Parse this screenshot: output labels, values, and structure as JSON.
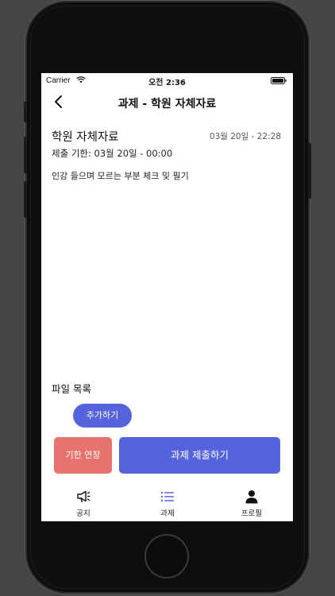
{
  "status_bar": {
    "carrier": "Carrier",
    "time": "오전 2:36"
  },
  "nav": {
    "title": "과제 - 학원 자체자료"
  },
  "assignment": {
    "title": "학원 자체자료",
    "posted_at": "03월 20일 - 22:28",
    "deadline": "제출 기한: 03월 20일 - 00:00",
    "content": "인강 들으며 모르는 부분 체크 및 필기"
  },
  "files": {
    "heading": "파일 목록",
    "add_label": "추가하기"
  },
  "actions": {
    "extend_label": "기한 연장",
    "submit_label": "과제 제출하기"
  },
  "tabs": [
    {
      "label": "공지",
      "icon": "megaphone-icon",
      "active": false
    },
    {
      "label": "과제",
      "icon": "list-icon",
      "active": true
    },
    {
      "label": "프로필",
      "icon": "person-icon",
      "active": false
    }
  ],
  "colors": {
    "primary": "#5563dd",
    "danger": "#e7736e",
    "active_tab": "#5563dd"
  }
}
